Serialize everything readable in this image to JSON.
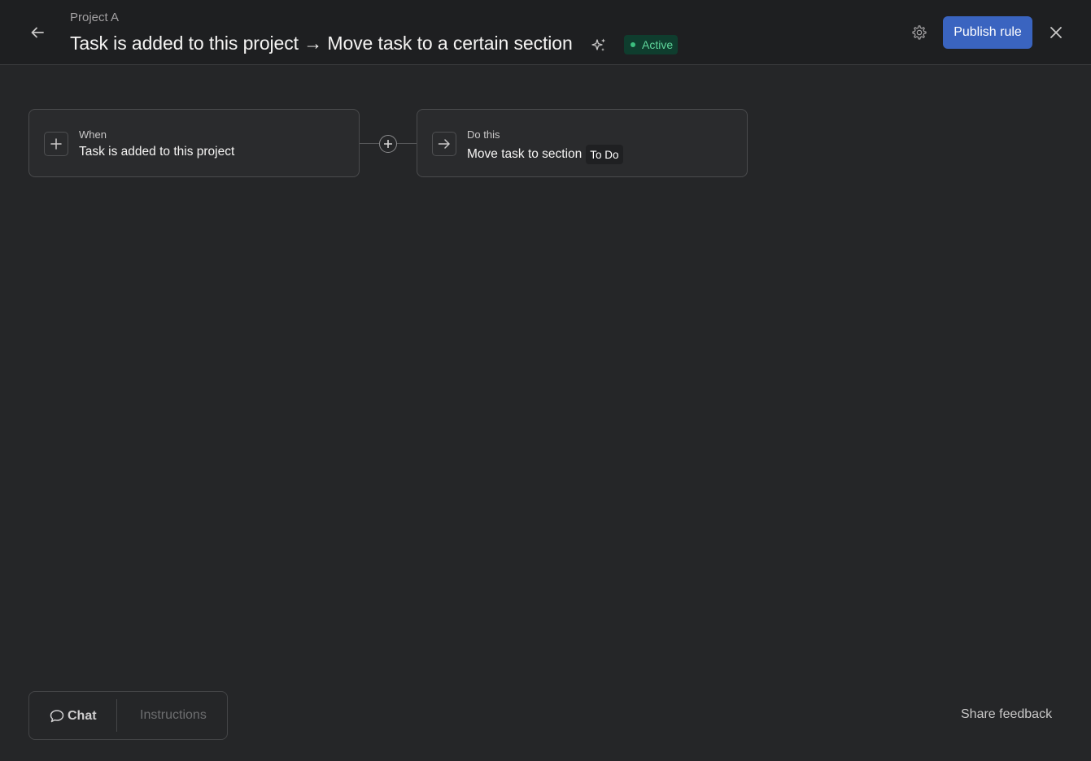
{
  "header": {
    "breadcrumb": "Project A",
    "title": "Task is added to this project → Move task to a certain section",
    "status": "Active",
    "publish_label": "Publish rule",
    "icons": {
      "back": "arrow-left-icon",
      "sparkle": "sparkle-icon",
      "settings": "gear-icon",
      "close": "close-icon"
    }
  },
  "rule": {
    "trigger": {
      "label": "When",
      "text": "Task is added to this project",
      "icon": "plus-icon"
    },
    "action": {
      "label": "Do this",
      "text": "Move task to section",
      "section": "To Do",
      "icon": "arrow-right-icon"
    },
    "connector_icon": "plus-circle-icon"
  },
  "footer": {
    "tabs": {
      "chat": "Chat",
      "instructions": "Instructions"
    },
    "share_feedback": "Share feedback"
  },
  "colors": {
    "accent": "#3a64c0",
    "status_bg": "#0f3d2e",
    "status_text": "#5fd69b",
    "background": "#252628",
    "header_bg": "#1e1f21"
  }
}
